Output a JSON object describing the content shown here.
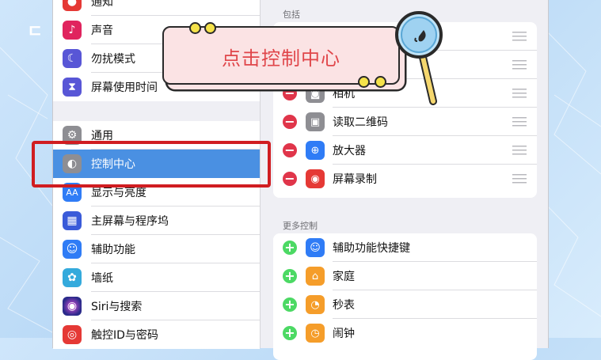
{
  "background": {
    "logo_text": "ㄷ ⊥"
  },
  "sidebar": {
    "items": [
      {
        "label": "通知",
        "icon": "bell-icon",
        "color": "#e53935",
        "glyph": "🔔"
      },
      {
        "label": "声音",
        "icon": "sound-icon",
        "color": "#e0245e",
        "glyph": "♪"
      },
      {
        "label": "勿扰模式",
        "icon": "moon-icon",
        "color": "#5856d6",
        "glyph": "☾"
      },
      {
        "label": "屏幕使用时间",
        "icon": "hourglass-icon",
        "color": "#5856d6",
        "glyph": "⧗"
      },
      {
        "label": "通用",
        "icon": "gear-icon",
        "color": "#8e8e93",
        "glyph": "⚙"
      },
      {
        "label": "控制中心",
        "icon": "toggle-icon",
        "color": "#8e8e93",
        "glyph": "◐",
        "selected": true
      },
      {
        "label": "显示与亮度",
        "icon": "text-size-icon",
        "color": "#2f7cf6",
        "glyph": "AA"
      },
      {
        "label": "主屏幕与程序坞",
        "icon": "grid-icon",
        "color": "#3a5bd9",
        "glyph": "▦"
      },
      {
        "label": "辅助功能",
        "icon": "accessibility-icon",
        "color": "#2f7cf6",
        "glyph": "☺"
      },
      {
        "label": "墙纸",
        "icon": "flower-icon",
        "color": "#34aadc",
        "glyph": "✿"
      },
      {
        "label": "Siri与搜索",
        "icon": "siri-icon",
        "color": "#222",
        "glyph": "◉"
      },
      {
        "label": "触控ID与密码",
        "icon": "fingerprint-icon",
        "color": "#e53935",
        "glyph": "◎"
      }
    ]
  },
  "main": {
    "included_header": "包括",
    "included": [
      {
        "label": "",
        "icon": "",
        "color": "#fff",
        "glyph": ""
      },
      {
        "label": "",
        "icon": "",
        "color": "#fff",
        "glyph": ""
      },
      {
        "label": "相机",
        "icon": "camera-icon",
        "color": "#8e8e93",
        "glyph": "◙"
      },
      {
        "label": "读取二维码",
        "icon": "qr-code-icon",
        "color": "#8e8e93",
        "glyph": "▣"
      },
      {
        "label": "放大器",
        "icon": "magnifier-icon",
        "color": "#2f7cf6",
        "glyph": "⊕"
      },
      {
        "label": "屏幕录制",
        "icon": "record-icon",
        "color": "#e53935",
        "glyph": "◉"
      }
    ],
    "more_header": "更多控制",
    "more": [
      {
        "label": "辅助功能快捷键",
        "icon": "accessibility-icon",
        "color": "#2f7cf6",
        "glyph": "☺"
      },
      {
        "label": "家庭",
        "icon": "home-icon",
        "color": "#f59d2a",
        "glyph": "⌂"
      },
      {
        "label": "秒表",
        "icon": "stopwatch-icon",
        "color": "#f59d2a",
        "glyph": "◔"
      },
      {
        "label": "闹钟",
        "icon": "alarm-icon",
        "color": "#f59d2a",
        "glyph": "⏰"
      }
    ]
  },
  "annotation": {
    "callout_text": "点击控制中心"
  },
  "colors": {
    "remove": "#e0354a",
    "add": "#4cd964",
    "accent": "#4a90e2",
    "highlight": "#d01d21"
  }
}
